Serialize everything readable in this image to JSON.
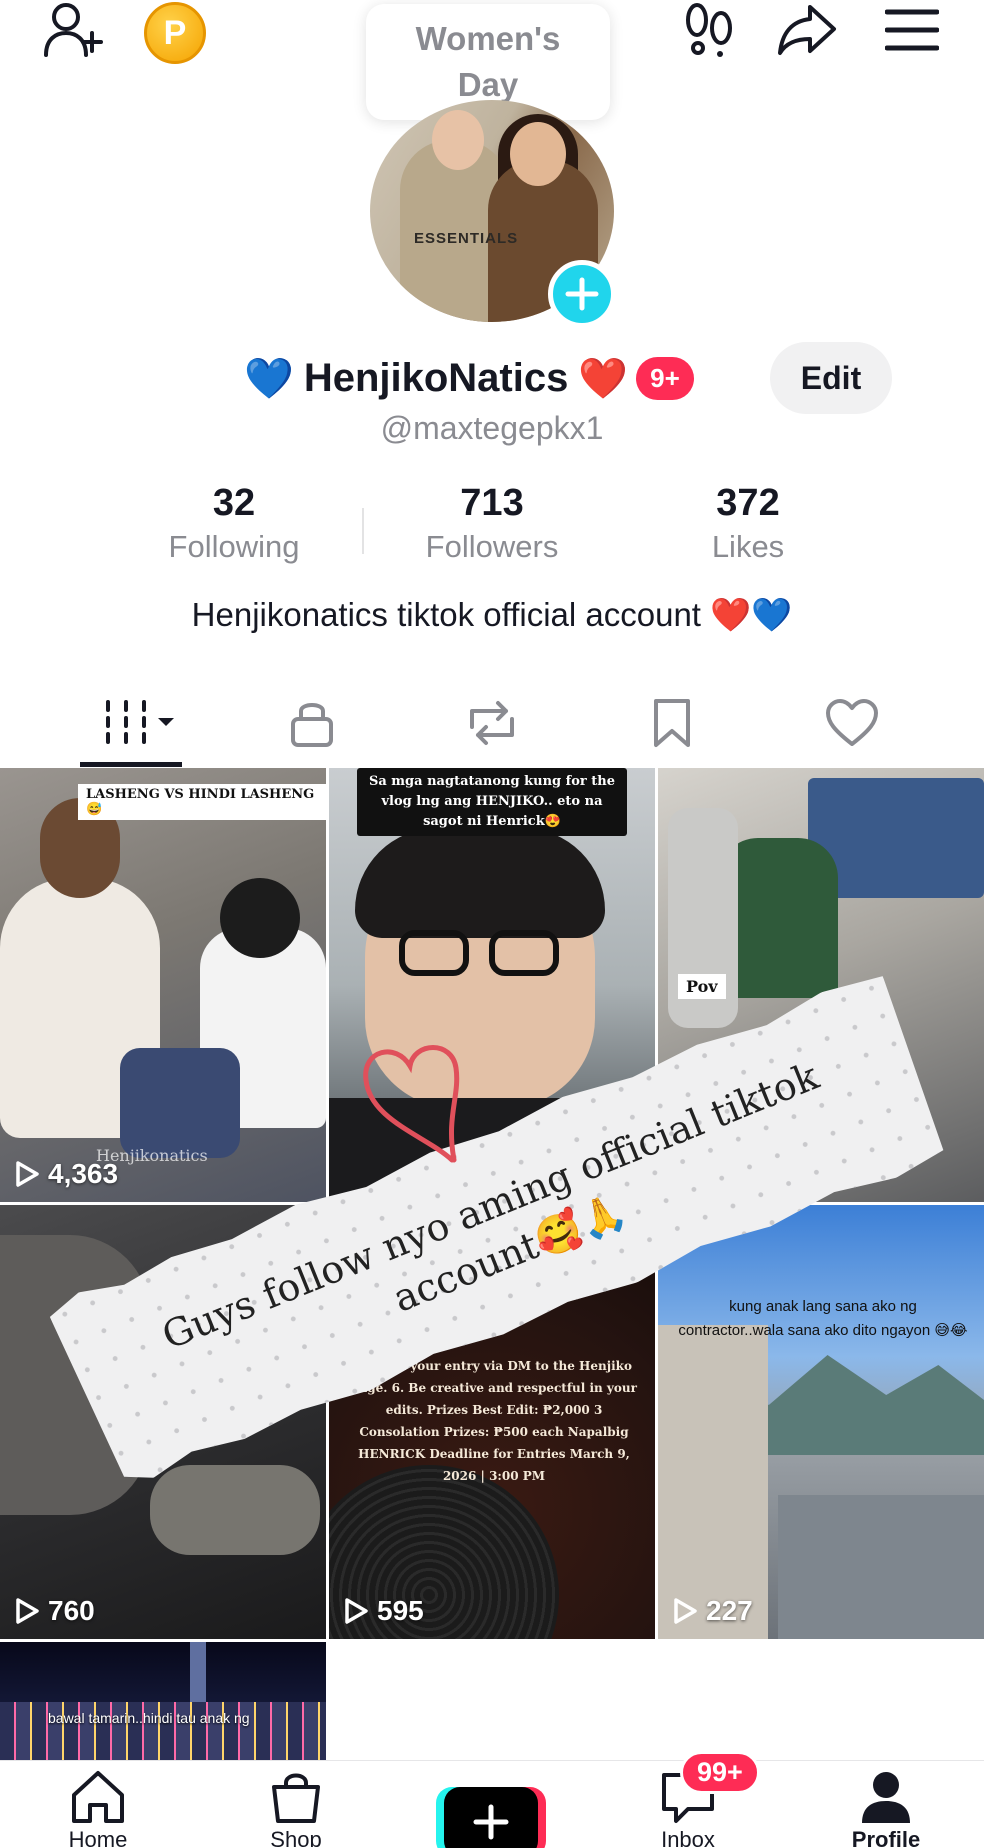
{
  "tooltip": {
    "line1": "Women's",
    "line2": "Day"
  },
  "top_bar": {
    "coin_letter": "P"
  },
  "avatar": {
    "shirt_text": "ESSENTIALS"
  },
  "profile": {
    "emoji_left": "💙",
    "display_name": "HenjikoNatics",
    "emoji_right": "❤️",
    "badge": "9+",
    "edit_label": "Edit",
    "username": "@maxtegepkx1",
    "bio": "Henjikonatics tiktok official account ❤️💙"
  },
  "stats": [
    {
      "value": "32",
      "label": "Following"
    },
    {
      "value": "713",
      "label": "Followers"
    },
    {
      "value": "372",
      "label": "Likes"
    }
  ],
  "videos": [
    {
      "views": "4,363",
      "caption": "LASHENG VS HINDI LASHENG😅",
      "watermark": "Henjikonatics"
    },
    {
      "views": "",
      "caption": "Sa mga nagtatanong kung for the vlog lng ang HENJIKO.. eto na sagot ni Henrick😍"
    },
    {
      "views": "",
      "caption": "Pov"
    },
    {
      "views": "760",
      "caption": ""
    },
    {
      "views": "595",
      "caption": "5. Send your entry via DM to the Henjiko page. 6. Be creative and respectful in your edits. Prizes Best Edit: ₱2,000 3 Consolation Prizes: ₱500 each Napalbig HENRICK Deadline for Entries March 9, 2026 | 3:00 PM"
    },
    {
      "views": "227",
      "caption": "kung anak lang sana ako ng contractor..wala sana ako dito ngayon 😅😂"
    },
    {
      "views": "",
      "caption": "bawal tamarin..hindi tau anak ng"
    }
  ],
  "note": {
    "text": "Guys follow nyo aming official tiktok account🥰🙏"
  },
  "bottom_nav": {
    "home": "Home",
    "shop": "Shop",
    "inbox": "Inbox",
    "inbox_badge": "99+",
    "profile": "Profile"
  },
  "colors": {
    "accent": "#fe2c55",
    "cyan": "#20d5ec",
    "text": "#161823",
    "muted": "#8a8b91"
  }
}
